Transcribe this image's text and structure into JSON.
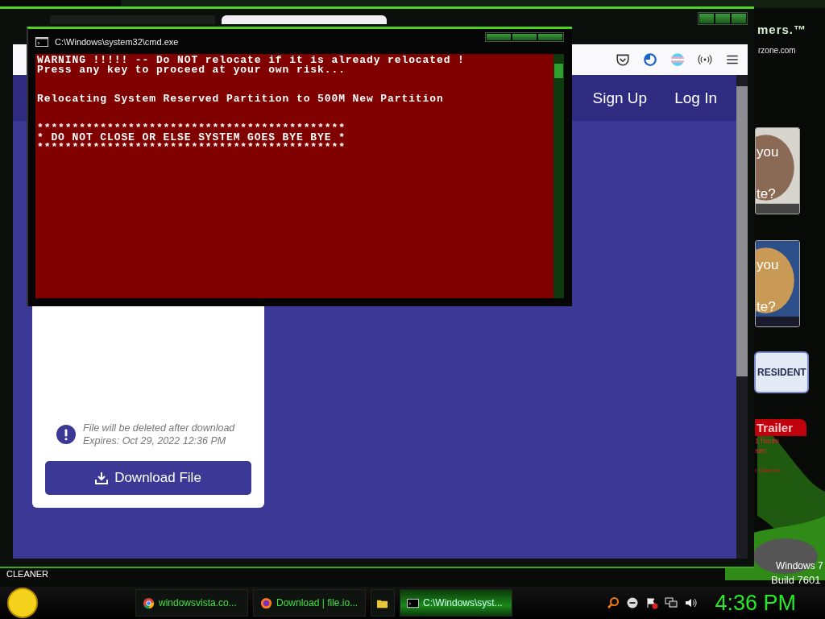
{
  "browser": {
    "tabs": [
      {
        "selected": false
      },
      {
        "selected": true
      }
    ],
    "nav": [
      "Sign Up",
      "Log In"
    ],
    "card": {
      "notice": [
        "File will be deleted after download",
        "Expires: Oct 29, 2022 12:36 PM"
      ],
      "button": "Download File"
    }
  },
  "console_window": {
    "title": "C:\\Windows\\system32\\cmd.exe",
    "blocks": [
      [
        "WARNING !!!!! -- Do NOT relocate if it is already relocated !",
        "Press any key to proceed at your own risk..."
      ],
      [
        "Relocating System Reserved Partition to 500M New Partition"
      ],
      [
        "********************************************",
        "* DO NOT CLOSE OR ELSE SYSTEM GOES BYE BYE *",
        "********************************************"
      ]
    ]
  },
  "desktop": {
    "logo": "mers.™",
    "site": "rzone.com",
    "ads": [
      {
        "top": "you",
        "bottom": "te?"
      },
      {
        "top": "you",
        "bottom": "te?"
      }
    ],
    "banner": "RESIDENT",
    "trailer": {
      "title": "Trailer",
      "lines": [
        "1 hours",
        "sec"
      ],
      "link": "r Games"
    },
    "cleaner": "CLEANER",
    "os": "Windows 7",
    "build": "Build 7601"
  },
  "taskbar": {
    "items": [
      {
        "kind": "chrome",
        "label": "windowsvista.co...",
        "selected": false
      },
      {
        "kind": "firefox",
        "label": "Download | file.io...",
        "selected": false
      },
      {
        "kind": "folder",
        "selected": false
      },
      {
        "kind": "console",
        "label": "C:\\Windows\\syst...",
        "selected": true
      }
    ],
    "clock": "4:36 PM"
  }
}
